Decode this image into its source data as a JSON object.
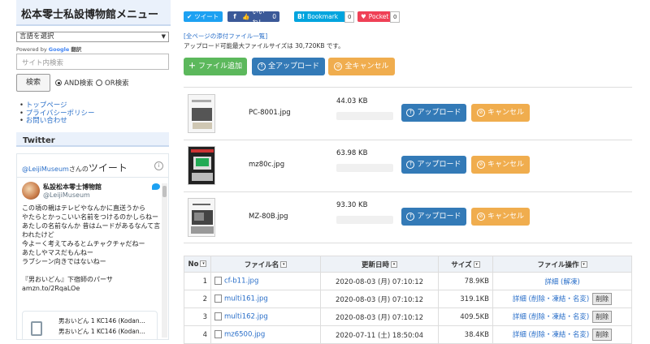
{
  "sidebar": {
    "title": "松本零士私設博物館メニュー",
    "language_select": "言語を選択",
    "powered_by": "Powered by",
    "google": "Google",
    "translate": "翻訳",
    "search_placeholder": "サイト内検索",
    "search_button": "検索",
    "and_search": "AND検索",
    "or_search": "OR検索",
    "links": [
      "トップページ",
      "プライバシーポリシー",
      "お問い合わせ"
    ],
    "twitter_heading": "Twitter",
    "tweets_title_handle": "@LeijiMuseum",
    "tweets_title_suffix": "さんの",
    "tweets_title_big": "ツイート",
    "tweet_user_name": "私設松本零士博物館",
    "tweet_user_handle": "@LeijiMuseum",
    "tweet_text": "この頃の親はテレビやなんかに直送うから\nやたらとかっこいい名前をつけるのかしらねー\nあたしの名前なんか 昔はムードがあるなんて言われたけど\n今よーく考えてみるとムチャクチャだねー\nあたしやマスだもんねー\nラブシーン向きではないねー\n\n『男おいどん』下宿師のパーサ\namzn.to/2RqaLOe",
    "tweet_link": "amzn.to/2RqaLOe",
    "card_line1": "男おいどん 1 KC146 (Kodan...",
    "card_line2": "男おいどん 1 KC146 (Kodan..."
  },
  "share": {
    "tweet": "ツイート",
    "like": "いいね！",
    "like_count": "0",
    "bookmark": "Bookmark",
    "bookmark_count": "0",
    "pocket": "Pocket",
    "pocket_count": "0"
  },
  "upload": {
    "all_files_link": "[全ページの添付ファイル一覧]",
    "max_size_text": "アップロード可能最大ファイルサイズは 30,720KB です。",
    "add_file": "ファイル追加",
    "upload_all": "全アップロード",
    "cancel_all": "全キャンセル",
    "upload": "アップロード",
    "cancel": "キャンセル"
  },
  "pending_files": [
    {
      "name": "PC-8001.jpg",
      "size": "44.03 KB",
      "progress": 0
    },
    {
      "name": "mz80c.jpg",
      "size": "63.98 KB",
      "progress": 0
    },
    {
      "name": "MZ-80B.jpg",
      "size": "93.30 KB",
      "progress": 0
    }
  ],
  "table": {
    "headers": [
      "No",
      "ファイル名",
      "更新日時",
      "サイズ",
      "ファイル操作"
    ],
    "delete_label": "削除",
    "rows": [
      {
        "no": "1",
        "file": "cf-b11.jpg",
        "date": "2020-08-03 (月) 07:10:12",
        "size": "78.9KB",
        "op": "詳細 (解凍)",
        "delete": false
      },
      {
        "no": "2",
        "file": "multi161.jpg",
        "date": "2020-08-03 (月) 07:10:12",
        "size": "319.1KB",
        "op": "詳細 (削除・凍結・名変)",
        "delete": true
      },
      {
        "no": "3",
        "file": "multi162.jpg",
        "date": "2020-08-03 (月) 07:10:12",
        "size": "409.5KB",
        "op": "詳細 (削除・凍結・名変)",
        "delete": true
      },
      {
        "no": "4",
        "file": "mz6500.jpg",
        "date": "2020-07-11 (土) 18:50:04",
        "size": "38.4KB",
        "op": "詳細 (削除・凍結・名変)",
        "delete": true
      }
    ]
  },
  "colors": {
    "green": "#5cb85c",
    "blue": "#337ab7",
    "orange": "#f0ad4e",
    "twitter": "#1da1f2",
    "facebook": "#3b5998",
    "hatena": "#00a4de",
    "pocket": "#ef4056"
  }
}
